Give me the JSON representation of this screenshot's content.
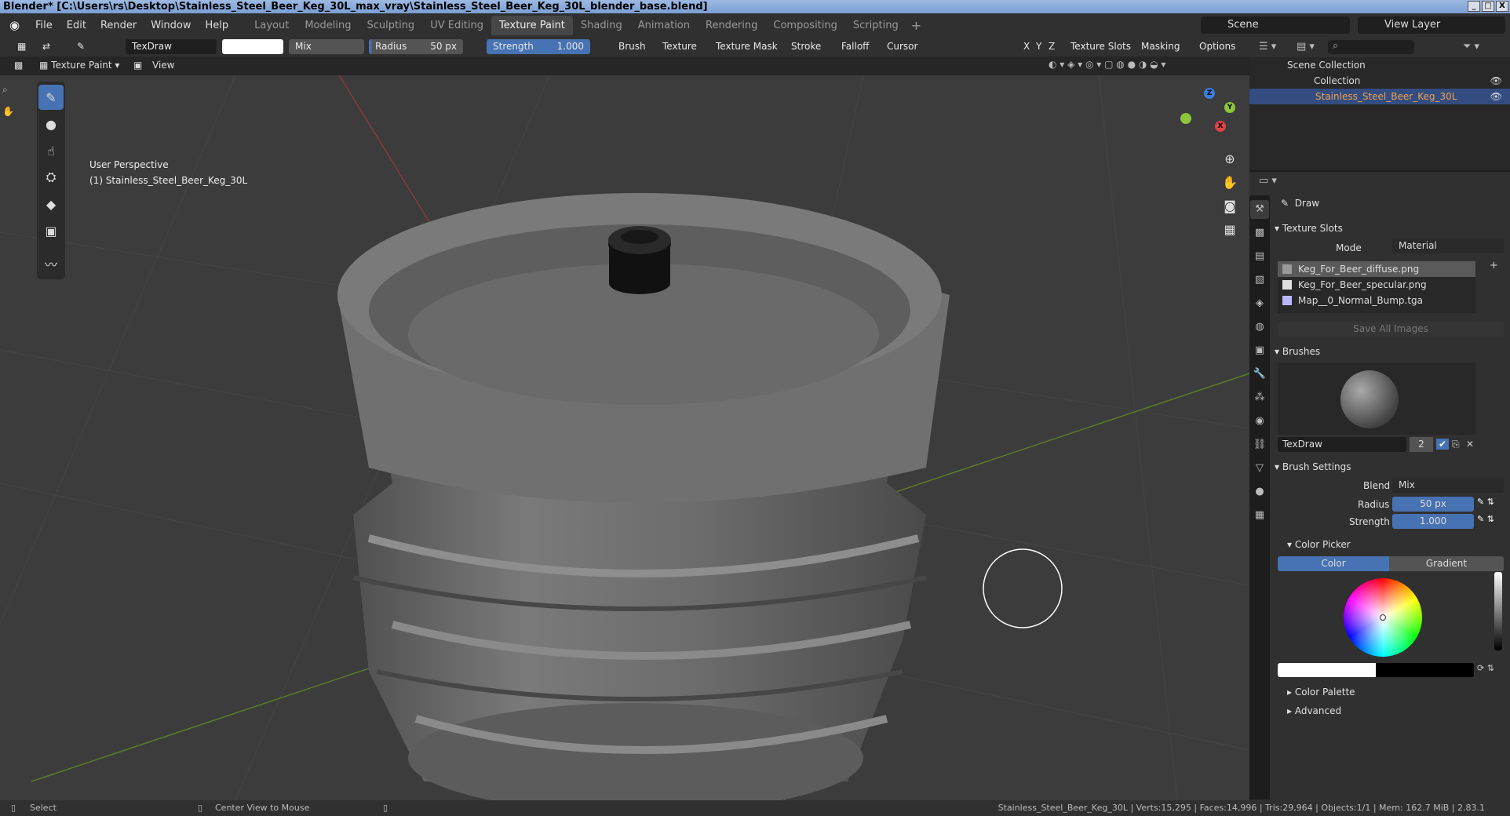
{
  "window": {
    "title": "Blender* [C:\\Users\\rs\\Desktop\\Stainless_Steel_Beer_Keg_30L_max_vray\\Stainless_Steel_Beer_Keg_30L_blender_base.blend]"
  },
  "menu": [
    "File",
    "Edit",
    "Render",
    "Window",
    "Help"
  ],
  "workspaces": [
    "Layout",
    "Modeling",
    "Sculpting",
    "UV Editing",
    "Texture Paint",
    "Shading",
    "Animation",
    "Rendering",
    "Compositing",
    "Scripting"
  ],
  "scene": "Scene",
  "view_layer": "View Layer",
  "tool_header": {
    "brush_name": "TexDraw",
    "blend": "Mix",
    "radius_label": "Radius",
    "radius_value": "50 px",
    "strength_label": "Strength",
    "strength_value": "1.000",
    "brush": "Brush",
    "texture": "Texture",
    "texture_mask": "Texture Mask",
    "stroke": "Stroke",
    "falloff": "Falloff",
    "cursor": "Cursor",
    "x": "X",
    "y": "Y",
    "z": "Z",
    "texture_slots": "Texture Slots",
    "masking": "Masking",
    "options": "Options"
  },
  "subheader": {
    "mode": "Texture Paint",
    "view": "View"
  },
  "viewport": {
    "perspective": "User Perspective",
    "object": "(1) Stainless_Steel_Beer_Keg_30L"
  },
  "outliner": {
    "scene_collection": "Scene Collection",
    "collection": "Collection",
    "object": "Stainless_Steel_Beer_Keg_30L"
  },
  "properties": {
    "tool": "Draw",
    "texture_slots": "Texture Slots",
    "mode_label": "Mode",
    "mode_value": "Material",
    "slots": [
      {
        "name": "Keg_For_Beer_diffuse.png",
        "color": "#9a9a9a"
      },
      {
        "name": "Keg_For_Beer_specular.png",
        "color": "#e0e0e0"
      },
      {
        "name": "Map__0_Normal_Bump.tga",
        "color": "#b8b8f8"
      }
    ],
    "save_all": "Save All Images",
    "brushes": "Brushes",
    "brush_name": "TexDraw",
    "brush_users": "2",
    "brush_settings": "Brush Settings",
    "blend_label": "Blend",
    "blend_value": "Mix",
    "radius_label": "Radius",
    "radius_value": "50 px",
    "strength_label": "Strength",
    "strength_value": "1.000",
    "color_picker": "Color Picker",
    "color_tab": "Color",
    "gradient_tab": "Gradient",
    "color_palette": "Color Palette",
    "advanced": "Advanced"
  },
  "status": {
    "select": "Select",
    "center": "Center View to Mouse",
    "stats": "Stainless_Steel_Beer_Keg_30L | Verts:15,295 | Faces:14,996 | Tris:29,964 | Objects:1/1 | Mem: 162.7 MiB | 2.83.1"
  },
  "gizmo": {
    "x": "X",
    "y": "Y",
    "z": "Z"
  },
  "colors": {
    "accent": "#4772b3",
    "x_axis": "#e0404a",
    "y_axis": "#8cc43a",
    "z_axis": "#3a7de0"
  }
}
